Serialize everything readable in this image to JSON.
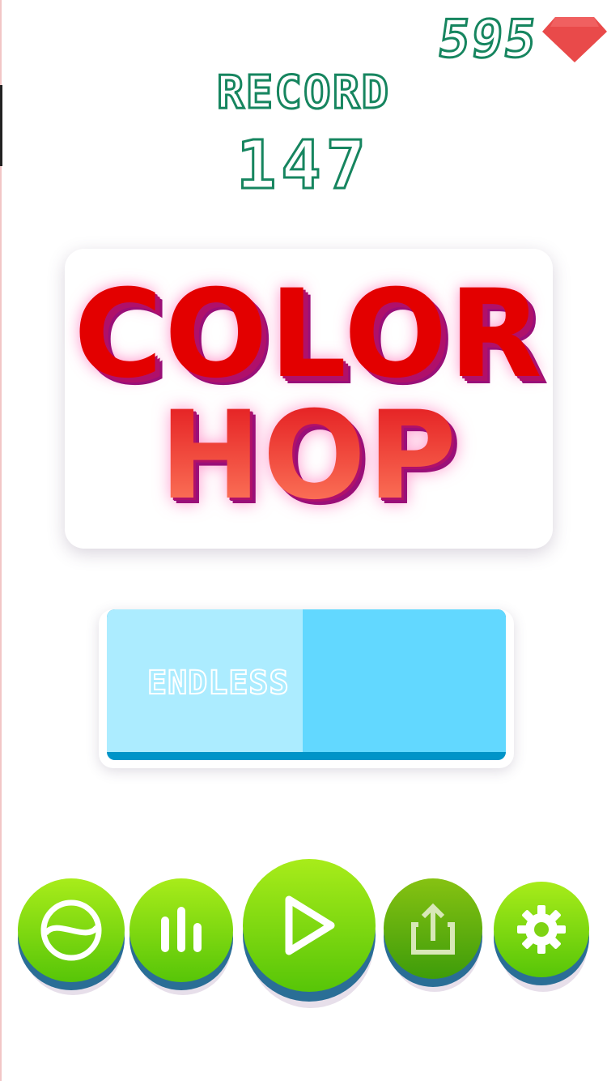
{
  "currency": {
    "count": "595",
    "icon": "gem-icon",
    "gem_color": "#e94a4a"
  },
  "record": {
    "label": "RECORD",
    "value": "147"
  },
  "logo": {
    "line1": "COLOR",
    "line2": "HOP"
  },
  "mode": {
    "label": "ENDLESS"
  },
  "toolbar": {
    "buttons": [
      {
        "icon": "ball-icon"
      },
      {
        "icon": "stats-bars-icon"
      },
      {
        "icon": "play-icon"
      },
      {
        "icon": "share-icon"
      },
      {
        "icon": "gear-icon"
      }
    ]
  },
  "colors": {
    "outline_green": "#16855f",
    "button_green_top": "#a8ec1a",
    "button_green_bottom": "#57c508",
    "mode_light": "#acecff",
    "mode_mid": "#62d8ff",
    "mode_base": "#0094c8",
    "logo_red": "#e30000"
  }
}
